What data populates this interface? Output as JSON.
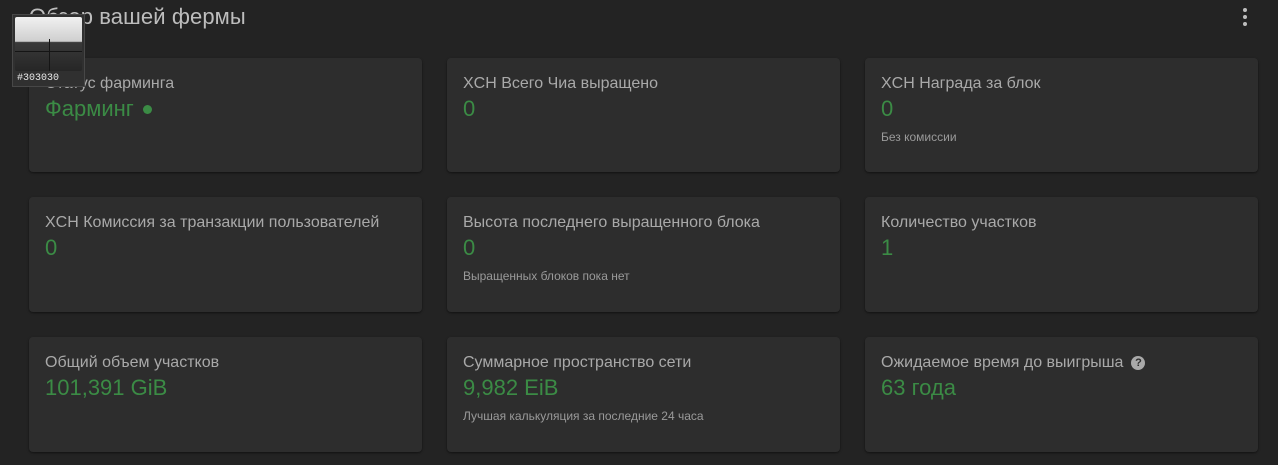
{
  "header": {
    "title": "Обзор вашей фермы",
    "menu_icon": "more-vert-icon"
  },
  "swatch": {
    "label": "#303030",
    "color": "#303030"
  },
  "colors": {
    "accent": "#3b8b45",
    "card_bg": "#2d2d2d",
    "page_bg": "#232323"
  },
  "cards": [
    {
      "title": "Статус фарминга",
      "value": "Фарминг",
      "status_icon": "status-dot-icon",
      "note": ""
    },
    {
      "title": "XCH Всего Чиа выращено",
      "value": "0",
      "note": ""
    },
    {
      "title": "XCH Награда за блок",
      "value": "0",
      "note": "Без комиссии"
    },
    {
      "title": "XCH Комиссия за транзакции пользователей",
      "value": "0",
      "note": ""
    },
    {
      "title": "Высота последнего выращенного блока",
      "value": "0",
      "note": "Выращенных блоков пока нет"
    },
    {
      "title": "Количество участков",
      "value": "1",
      "note": ""
    },
    {
      "title": "Общий объем участков",
      "value": "101,391 GiB",
      "note": ""
    },
    {
      "title": "Суммарное пространство сети",
      "value": "9,982 EiB",
      "note": "Лучшая калькуляция за последние 24 часа"
    },
    {
      "title": "Ожидаемое время до выигрыша",
      "value": "63 года",
      "note": "",
      "help_icon": "help-icon"
    }
  ]
}
